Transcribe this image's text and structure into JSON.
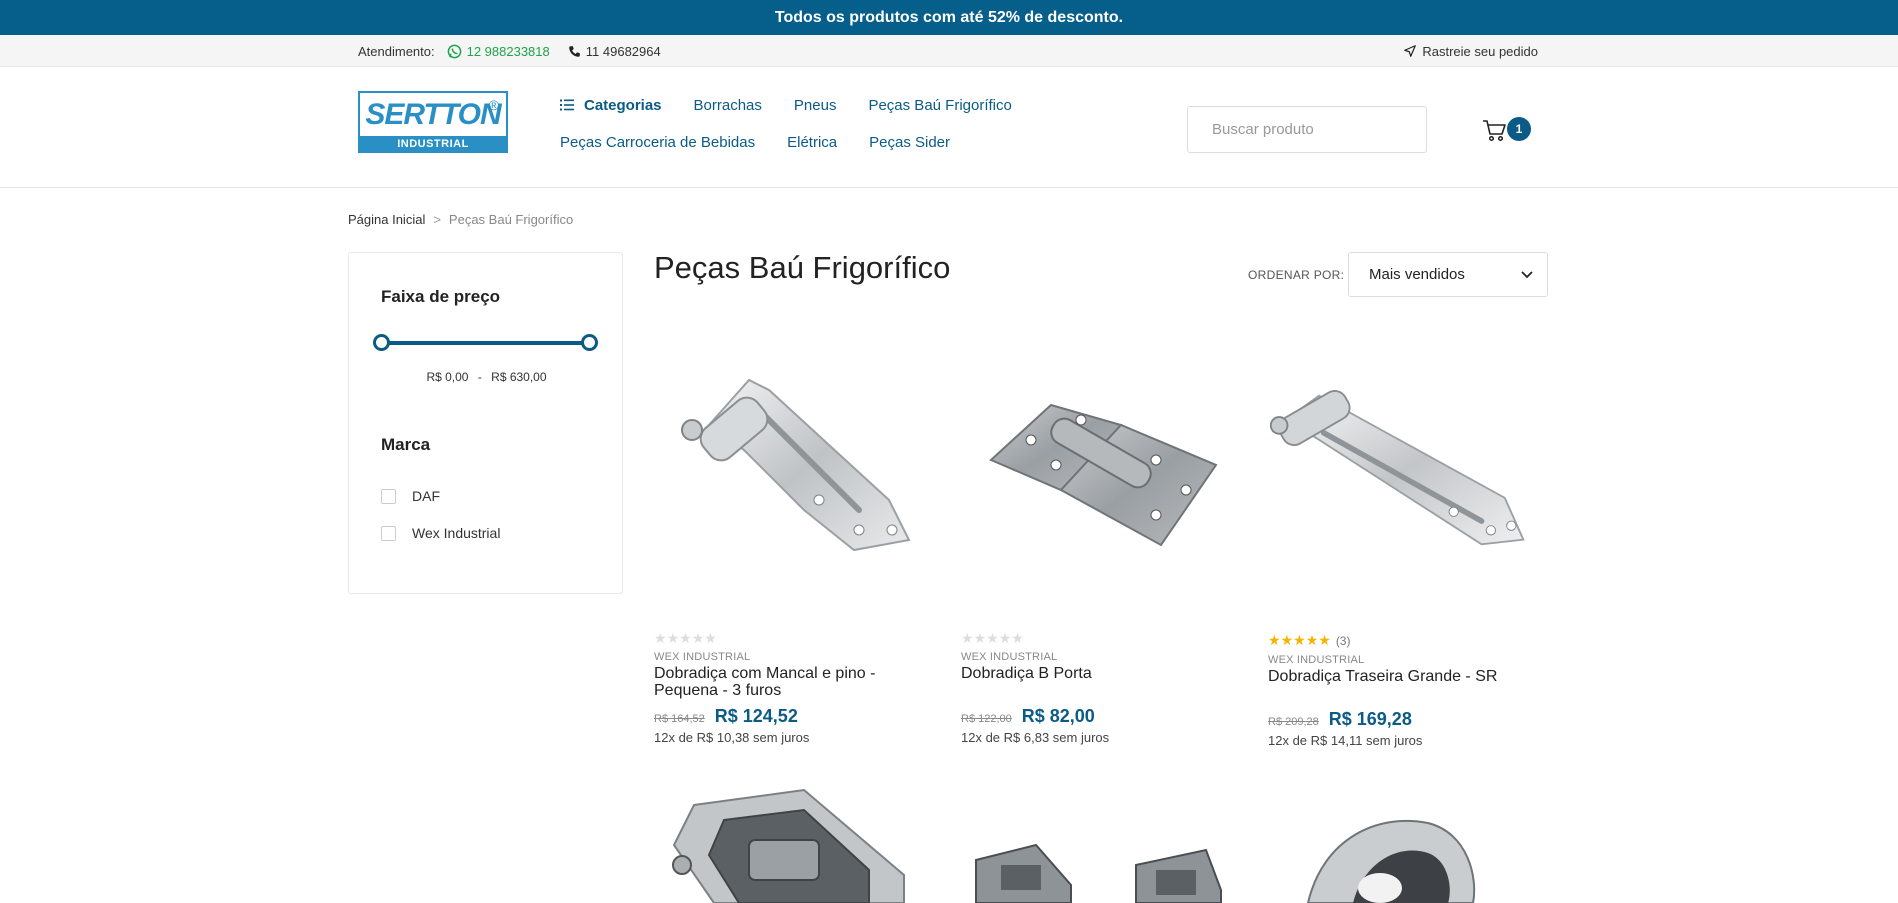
{
  "promo": {
    "text": "Todos os produtos com até 52% de desconto."
  },
  "contact": {
    "label": "Atendimento:",
    "whatsapp": "12 988233818",
    "phone": "11 49682964",
    "track": "Rastreie seu pedido"
  },
  "logo": {
    "name": "SERTTON",
    "reg": "®",
    "sub": "INDUSTRIAL"
  },
  "nav": {
    "categories": "Categorias",
    "items": [
      "Borrachas",
      "Pneus",
      "Peças Baú Frigorífico",
      "Peças Carroceria de Bebidas",
      "Elétrica",
      "Peças Sider"
    ]
  },
  "search": {
    "placeholder": "Buscar produto"
  },
  "cart": {
    "count": "1"
  },
  "breadcrumb": {
    "home": "Página Inicial",
    "separator": ">",
    "current": "Peças Baú Frigorífico"
  },
  "filters": {
    "price_title": "Faixa de preço",
    "price_min": "R$ 0,00",
    "price_sep": "-",
    "price_max": "R$ 630,00",
    "brand_title": "Marca",
    "brands": [
      "DAF",
      "Wex Industrial"
    ]
  },
  "page": {
    "title": "Peças Baú Frigorífico"
  },
  "sort": {
    "label": "ORDENAR POR:",
    "value": "Mais vendidos"
  },
  "products": [
    {
      "brand": "WEX INDUSTRIAL",
      "name": "Dobradiça com Mancal e pino - Pequena - 3 furos",
      "old_price": "R$ 164,52",
      "price": "R$ 124,52",
      "installments": "12x de R$ 10,38 sem juros",
      "rating": 0,
      "reviews": ""
    },
    {
      "brand": "WEX INDUSTRIAL",
      "name": "Dobradiça B Porta",
      "old_price": "R$ 122,00",
      "price": "R$ 82,00",
      "installments": "12x de R$ 6,83 sem juros",
      "rating": 0,
      "reviews": ""
    },
    {
      "brand": "WEX INDUSTRIAL",
      "name": "Dobradiça Traseira Grande - SR",
      "old_price": "R$ 209,28",
      "price": "R$ 169,28",
      "installments": "12x de R$ 14,11 sem juros",
      "rating": 5,
      "reviews": "(3)"
    }
  ],
  "colors": {
    "primary": "#065f8a",
    "accent": "#0b5b86",
    "whatsapp": "#1ea34a",
    "star": "#f5b400"
  }
}
